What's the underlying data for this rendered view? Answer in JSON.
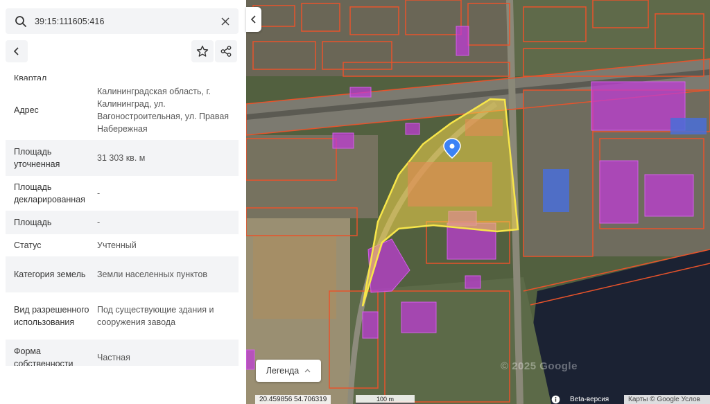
{
  "search": {
    "value": "39:15:111605:416"
  },
  "properties": {
    "partial_label": "Квартал",
    "rows": [
      {
        "label": "Адрес",
        "value": "Калининградская область, г. Калининград, ул. Вагоностроительная, ул. Правая Набережная"
      },
      {
        "label": "Площадь уточненная",
        "value": "31 303 кв. м"
      },
      {
        "label": "Площадь декларированная",
        "value": "-"
      },
      {
        "label": "Площадь",
        "value": "-"
      },
      {
        "label": "Статус",
        "value": "Учтенный"
      },
      {
        "label": "Категория земель",
        "value": "Земли населенных пунктов"
      },
      {
        "label": "Вид разрешенного использования",
        "value": "Под существующие здания и сооружения завода"
      },
      {
        "label": "Форма собственности",
        "value": "Частная"
      }
    ]
  },
  "map": {
    "legend_label": "Легенда",
    "watermark": "© 2025 Google",
    "coordinates": "20.459856  54.706319",
    "scale_label": "100 m",
    "beta_label": "Beta-версия",
    "attribution": "Карты © Google  Услов"
  },
  "colors": {
    "parcel_outline": "#e8532b",
    "selected_fill": "#f2d64b",
    "building_fill": "#c03ad8",
    "marker": "#3b82f6"
  }
}
